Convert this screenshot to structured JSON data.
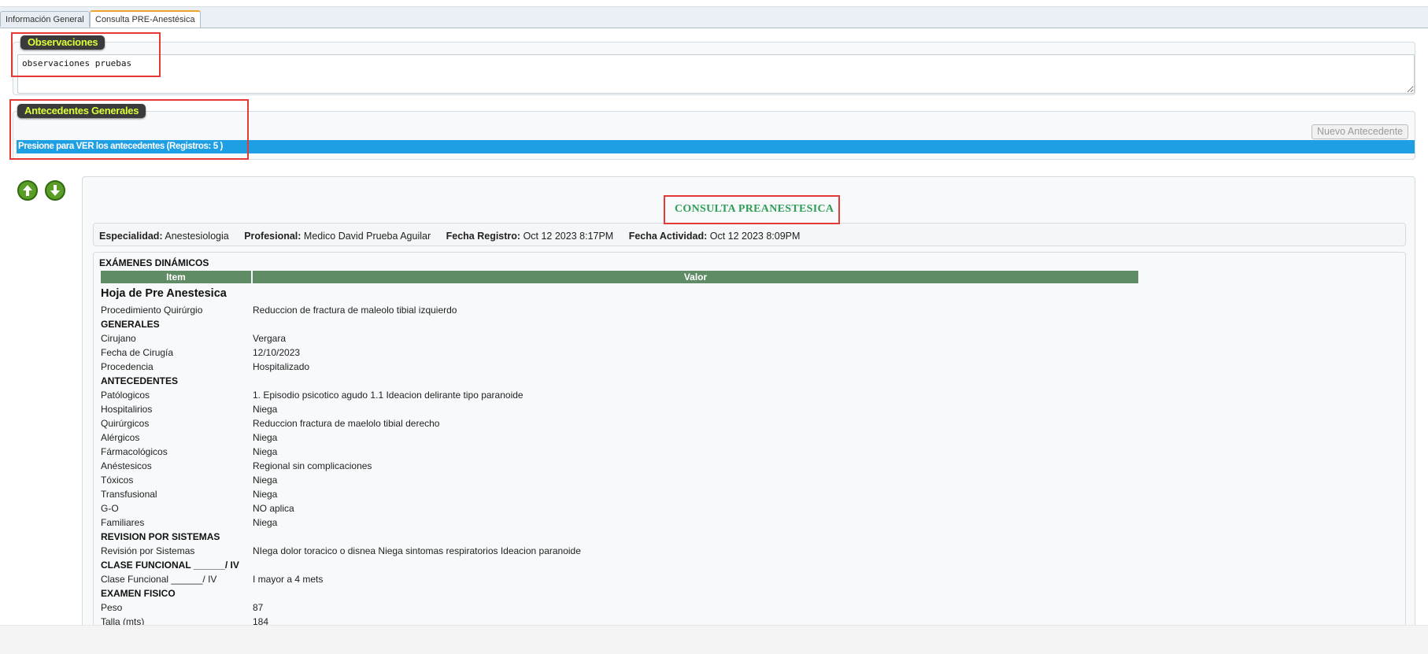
{
  "tabs": [
    {
      "label": "Información General",
      "active": false
    },
    {
      "label": "Consulta PRE-Anestésica",
      "active": true
    }
  ],
  "observaciones": {
    "legend": "Observaciones",
    "text": "observaciones pruebas"
  },
  "antecedentes": {
    "legend": "Antecedentes Generales",
    "new_button": "Nuevo Antecedente",
    "bar_text": "Presione para VER los antecedentes (Registros: 5 )"
  },
  "nav": {
    "up_icon": "arrow-up-icon",
    "down_icon": "arrow-down-icon"
  },
  "consulta": {
    "title": "CONSULTA PREANESTESICA",
    "meta": {
      "especialidad_label": "Especialidad:",
      "especialidad_value": "Anestesiologia",
      "profesional_label": "Profesional:",
      "profesional_value": "Medico David Prueba Aguilar",
      "fecha_registro_label": "Fecha Registro:",
      "fecha_registro_value": "Oct 12 2023 8:17PM",
      "fecha_actividad_label": "Fecha Actividad:",
      "fecha_actividad_value": "Oct 12 2023 8:09PM"
    },
    "exam_title": "EXÁMENES DINÁMICOS",
    "col_item": "Item",
    "col_valor": "Valor",
    "sheet_title": "Hoja de Pre Anestesica",
    "rows": [
      {
        "type": "row",
        "label": "Procedimiento Quirúrgio",
        "value": "Reduccion de fractura de maleolo tibial izquierdo"
      },
      {
        "type": "group",
        "label": "GENERALES"
      },
      {
        "type": "row",
        "label": "Cirujano",
        "value": "Vergara"
      },
      {
        "type": "row",
        "label": "Fecha de Cirugía",
        "value": "12/10/2023"
      },
      {
        "type": "row",
        "label": "Procedencia",
        "value": "Hospitalizado"
      },
      {
        "type": "group",
        "label": "ANTECEDENTES"
      },
      {
        "type": "row",
        "label": "Patólogicos",
        "value": "1. Episodio psicotico agudo 1.1 Ideacion delirante tipo paranoide"
      },
      {
        "type": "row",
        "label": "Hospitalirios",
        "value": "Niega"
      },
      {
        "type": "row",
        "label": "Quirúrgicos",
        "value": "Reduccion fractura de maelolo tibial derecho"
      },
      {
        "type": "row",
        "label": "Alérgicos",
        "value": "Niega"
      },
      {
        "type": "row",
        "label": "Fármacológicos",
        "value": "Niega"
      },
      {
        "type": "row",
        "label": "Anéstesicos",
        "value": "Regional sin complicaciones"
      },
      {
        "type": "row",
        "label": "Tóxicos",
        "value": "Niega"
      },
      {
        "type": "row",
        "label": "Transfusional",
        "value": "Niega"
      },
      {
        "type": "row",
        "label": "G-O",
        "value": "NO aplica"
      },
      {
        "type": "row",
        "label": "Familiares",
        "value": "Niega"
      },
      {
        "type": "group",
        "label": "REVISION POR SISTEMAS"
      },
      {
        "type": "row",
        "label": "Revisión por Sistemas",
        "value": "NIega dolor toracico o disnea Niega sintomas respiratorios Ideacion paranoide"
      },
      {
        "type": "group",
        "label": "CLASE FUNCIONAL ______/ IV"
      },
      {
        "type": "row",
        "label": "Clase Funcional ______/ IV",
        "value": "I mayor a 4 mets"
      },
      {
        "type": "group",
        "label": "EXAMEN FISICO"
      },
      {
        "type": "row",
        "label": "Peso",
        "value": "87"
      },
      {
        "type": "row",
        "label": "Talla (mts)",
        "value": "184"
      }
    ]
  }
}
